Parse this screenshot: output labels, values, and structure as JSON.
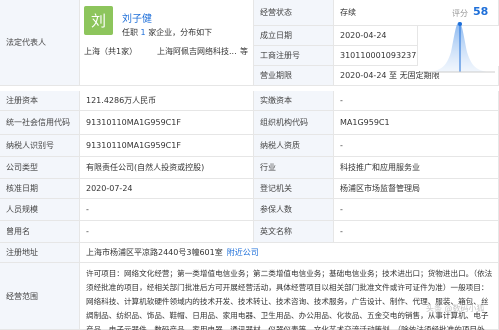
{
  "legal_rep": {
    "label": "法定代表人",
    "avatar_char": "刘",
    "name": "刘子健",
    "summary_pre": "任职",
    "summary_count": "1",
    "summary_post": "家企业，分布如下",
    "region": "上海（共1家）",
    "company": "上海阿佩吉网络科技...",
    "more": "等"
  },
  "status_label": "经营状态",
  "status_value": "存续",
  "score_label": "评分",
  "score_value": "58",
  "est_date_label": "成立日期",
  "est_date_value": "2020-04-24",
  "reg_no_label": "工商注册号",
  "reg_no_value": "310110001093237",
  "term_label": "营业期限",
  "term_value": "2020-04-24 至 无固定期限",
  "reg_capital_label": "注册资本",
  "reg_capital_value": "121.4286万人民币",
  "paid_capital_label": "实缴资本",
  "paid_capital_value": "-",
  "credit_code_label": "统一社会信用代码",
  "credit_code_value": "91310110MA1G959C1F",
  "org_code_label": "组织机构代码",
  "org_code_value": "MA1G959C1",
  "taxpayer_id_label": "纳税人识别号",
  "taxpayer_id_value": "91310110MA1G959C1F",
  "taxpayer_qual_label": "纳税人资质",
  "taxpayer_qual_value": "-",
  "company_type_label": "公司类型",
  "company_type_value": "有限责任公司(自然人投资或控股)",
  "industry_label": "行业",
  "industry_value": "科技推广和应用服务业",
  "approval_label": "核准日期",
  "approval_value": "2020-07-24",
  "authority_label": "登记机关",
  "authority_value": "杨浦区市场监督管理局",
  "staff_size_label": "人员规模",
  "staff_size_value": "-",
  "insured_label": "参保人数",
  "insured_value": "-",
  "former_name_label": "曾用名",
  "former_name_value": "-",
  "english_name_label": "英文名称",
  "english_name_value": "-",
  "address_label": "注册地址",
  "address_value": "上海市杨浦区平凉路2440号3幢601室",
  "address_link": "附近公司",
  "scope_label": "经营范围",
  "scope_value": "许可项目：网络文化经营；第一类增值电信业务；第二类增值电信业务；基础电信业务；技术进出口；货物进出口。（依法须经批准的项目，经相关部门批准后方可开展经营活动，具体经营项目以相关部门批准文件或许可证件为准）一般项目：网络科技、计算机软硬件领域内的技术开发、技术转让、技术咨询、技术服务，广告设计、制作、代理、服装、箱包、丝绸制品、纺织品、饰品、鞋帽、日用品、家用电器、卫生用品、办公用品、化妆品、五金交电的销售，从事计算机、电子产品、电子元器件、数码产品、家用电器、通讯器材、仪器仪表等，文化艺术交流活动策划。（除依法须经批准的项目外，凭营业执照依法自主开展经营活动）",
  "watermark": "头条 @数码小狐"
}
